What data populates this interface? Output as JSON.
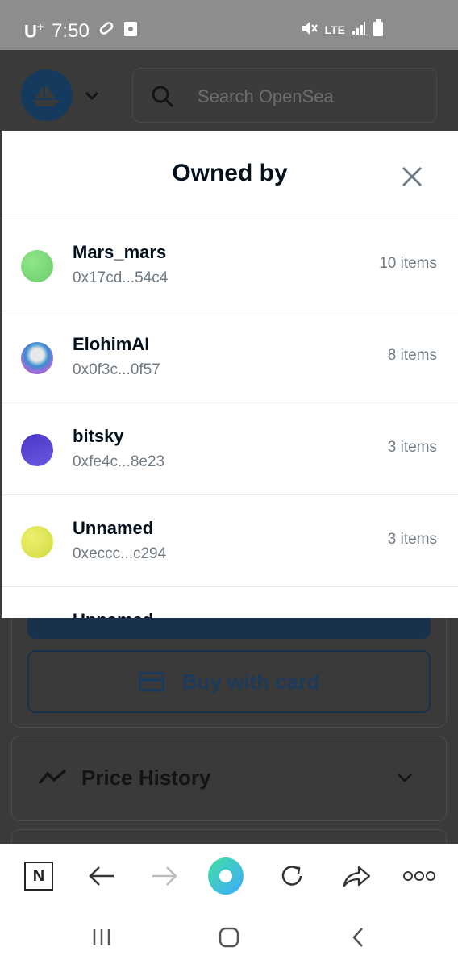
{
  "status_bar": {
    "carrier": "U",
    "carrier_sup": "+",
    "time": "7:50",
    "network": "LTE"
  },
  "header": {
    "search_placeholder": "Search OpenSea"
  },
  "modal": {
    "title": "Owned by",
    "owners": [
      {
        "name": "Mars_mars",
        "address": "0x17cd...54c4",
        "count": "10 items",
        "avatar_color": "#7ed77a"
      },
      {
        "name": "ElohimAI",
        "address": "0x0f3c...0f57",
        "count": "8 items",
        "avatar_color": "#8fb4c8"
      },
      {
        "name": "bitsky",
        "address": "0xfe4c...8e23",
        "count": "3 items",
        "avatar_color": "#5a45d6"
      },
      {
        "name": "Unnamed",
        "address": "0xeccc...c294",
        "count": "3 items",
        "avatar_color": "#dfe85a"
      }
    ],
    "partial_row_name": "Unnamed"
  },
  "page": {
    "buy_with_card": "Buy with card",
    "price_history": "Price History"
  },
  "colors": {
    "accent": "#2081e2",
    "text_primary": "#04111d",
    "text_secondary": "#707a83"
  }
}
